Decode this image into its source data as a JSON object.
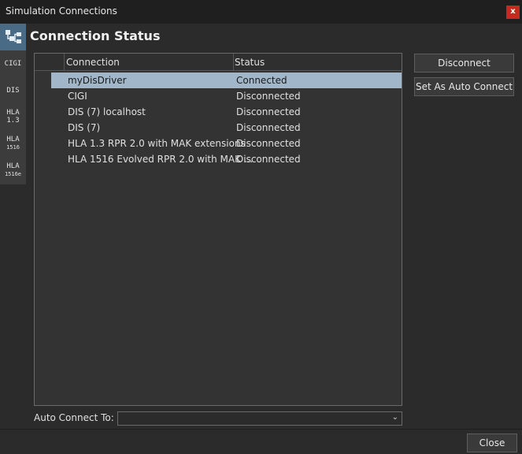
{
  "window": {
    "title": "Simulation Connections",
    "close_glyph": "x"
  },
  "sidebar": {
    "top_icon": "network-tree-icon",
    "items": [
      {
        "line1": "CIGI",
        "line2": ""
      },
      {
        "line1": "DIS",
        "line2": ""
      },
      {
        "line1": "HLA",
        "line2": "1.3"
      },
      {
        "line1": "HLA",
        "line2": "1516"
      },
      {
        "line1": "HLA",
        "line2": "1516e"
      }
    ]
  },
  "main": {
    "heading": "Connection Status"
  },
  "table": {
    "columns": [
      "Connection",
      "Status"
    ],
    "rows": [
      {
        "connection": "myDisDriver",
        "status": "Connected",
        "selected": true
      },
      {
        "connection": "CIGI",
        "status": "Disconnected"
      },
      {
        "connection": "DIS (7) localhost",
        "status": "Disconnected"
      },
      {
        "connection": "DIS (7)",
        "status": "Disconnected"
      },
      {
        "connection": "HLA 1.3 RPR 2.0 with MAK extensions",
        "status": "Disconnected"
      },
      {
        "connection": "HLA 1516 Evolved RPR 2.0 with MAK ...",
        "status": "Disconnected"
      }
    ]
  },
  "actions": {
    "disconnect": "Disconnect",
    "set_auto_connect": "Set As Auto Connect"
  },
  "auto_connect": {
    "label": "Auto Connect To:",
    "value": "",
    "chevron": "⌄"
  },
  "footer": {
    "close": "Close"
  },
  "colors": {
    "selection": "#a1b7c9",
    "close_button": "#c42b1c",
    "sidebar_active": "#4a6b85"
  }
}
